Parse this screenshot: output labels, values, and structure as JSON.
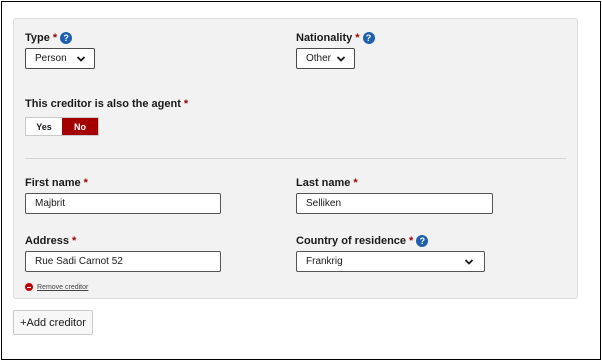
{
  "creditor": {
    "type": {
      "label": "Type",
      "required_mark": "*",
      "value": "Person"
    },
    "nationality": {
      "label": "Nationality",
      "required_mark": "*",
      "value": "Other"
    },
    "is_agent": {
      "label": "This creditor is also the agent",
      "required_mark": "*",
      "yes_label": "Yes",
      "no_label": "No",
      "selected": "No"
    },
    "first_name": {
      "label": "First name",
      "required_mark": "*",
      "value": "Majbrit"
    },
    "last_name": {
      "label": "Last name",
      "required_mark": "*",
      "value": "Selliken"
    },
    "address": {
      "label": "Address",
      "required_mark": "*",
      "value": "Rue Sadi Carnot 52"
    },
    "country_of_residence": {
      "label": "Country of residence",
      "required_mark": "*",
      "value": "Frankrig"
    },
    "remove_link": "Remove creditor"
  },
  "add_creditor_label": "+Add creditor",
  "help_glyph": "?",
  "colors": {
    "accent_red": "#a50000",
    "help_blue": "#1f5fae",
    "panel_bg": "#f2f2f2"
  }
}
